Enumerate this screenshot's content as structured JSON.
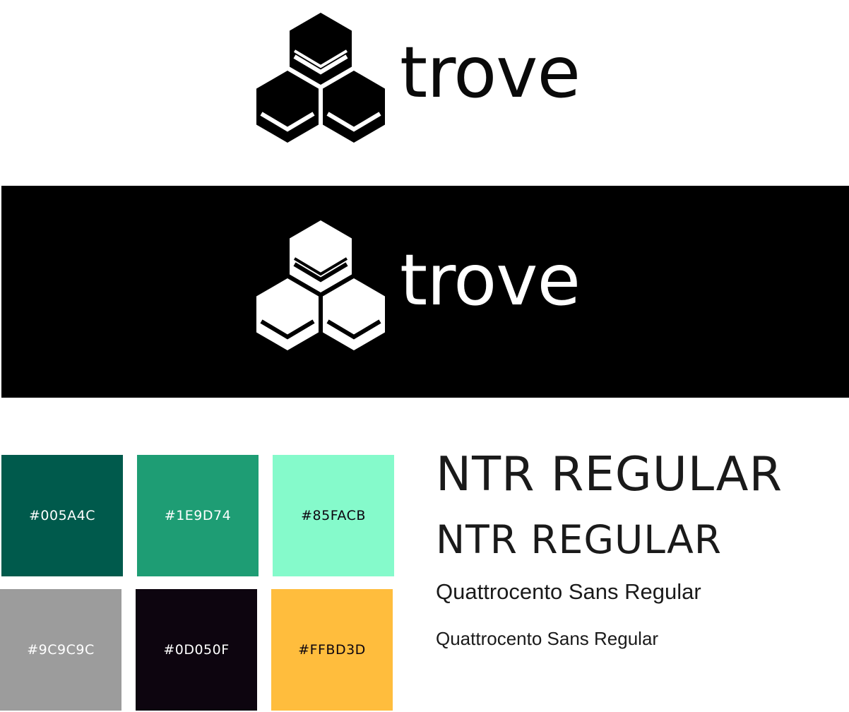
{
  "logo": {
    "wordmark": "trove",
    "icon": "hexagon-cluster-icon",
    "light_variant": {
      "background": "#FFFFFF",
      "foreground": "#000000"
    },
    "dark_variant": {
      "background": "#000000",
      "foreground": "#FFFFFF"
    }
  },
  "palette": [
    {
      "label": "#005A4C",
      "color": "#005A4C",
      "text_color": "#FFFFFF"
    },
    {
      "label": "#1E9D74",
      "color": "#1E9D74",
      "text_color": "#FFFFFF"
    },
    {
      "label": "#85FACB",
      "color": "#85FACB",
      "text_color": "#0D050F"
    },
    {
      "label": "#9C9C9C",
      "color": "#9C9C9C",
      "text_color": "#FFFFFF"
    },
    {
      "label": "#0D050F",
      "color": "#0D050F",
      "text_color": "#FFFFFF"
    },
    {
      "label": "#FFBD3D",
      "color": "#FFBD3D",
      "text_color": "#0D050F"
    }
  ],
  "typography": [
    {
      "label": "NTR REGULAR"
    },
    {
      "label": "NTR REGULAR"
    },
    {
      "label": "Quattrocento Sans Regular"
    },
    {
      "label": "Quattrocento Sans Regular"
    }
  ]
}
